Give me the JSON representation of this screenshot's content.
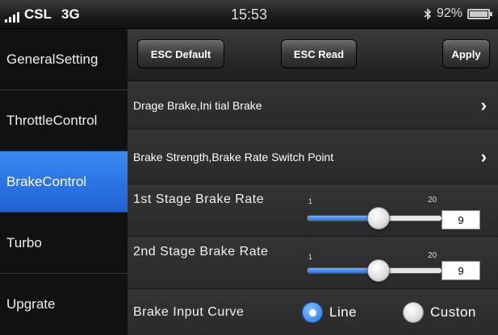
{
  "status_bar": {
    "carrier": "CSL",
    "network": "3G",
    "time": "15:53",
    "battery": "92%",
    "icons": [
      "signal-icon",
      "bluetooth-icon",
      "battery-icon"
    ]
  },
  "sidebar": {
    "items": [
      {
        "label": "GeneralSetting",
        "active": false
      },
      {
        "label": "ThrottleControl",
        "active": false
      },
      {
        "label": "BrakeControl",
        "active": true
      },
      {
        "label": "Turbo",
        "active": false
      },
      {
        "label": "Upgrate",
        "active": false
      }
    ]
  },
  "toolbar": {
    "esc_default": "ESC Default",
    "esc_read": "ESC Read",
    "apply": "Apply"
  },
  "rows": {
    "drag_brake": "Drage Brake,Ini tial Brake",
    "brake_strength": "Brake Strength,Brake Rate Switch Point",
    "stage1": {
      "label": "1st Stage Brake Rate",
      "min": "1",
      "max": "20",
      "value": "9"
    },
    "stage2": {
      "label": "2nd Stage Brake Rate",
      "min": "1",
      "max": "20",
      "value": "9"
    },
    "curve": {
      "label": "Brake Input Curve",
      "option_line": "Line",
      "option_custom": "Custon",
      "selected": "Line"
    }
  },
  "colors": {
    "accent": "#2a7ae4",
    "active_tab": "#1e62d6"
  }
}
